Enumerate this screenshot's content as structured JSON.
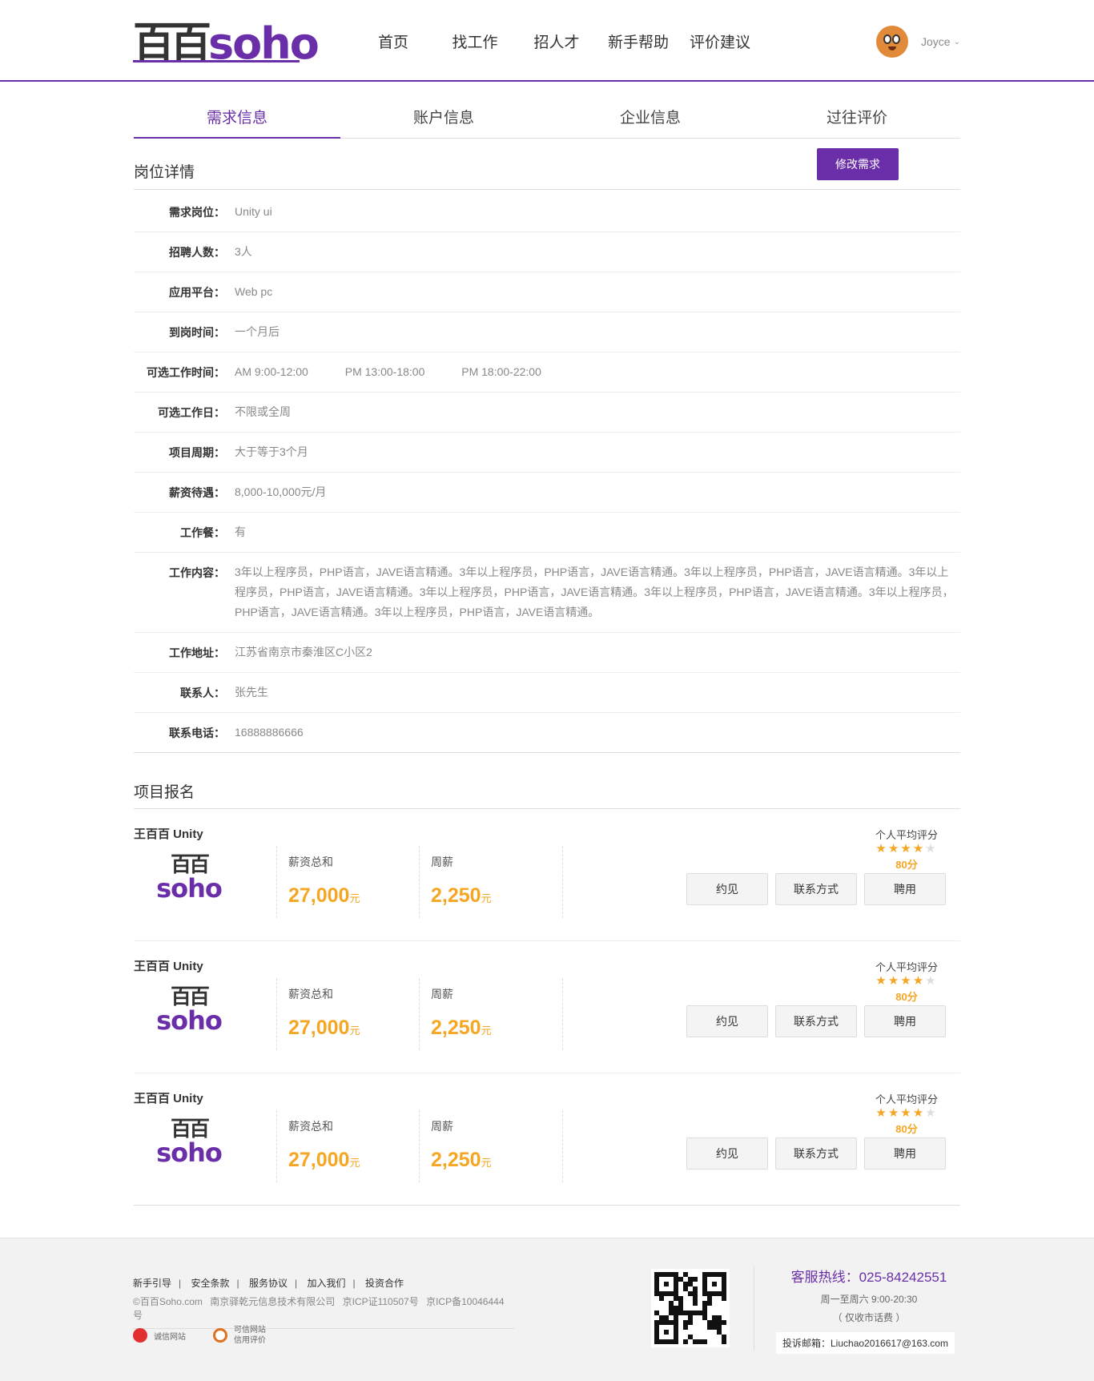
{
  "header": {
    "logo_han": "百百",
    "logo_latin": "soho",
    "nav": [
      "首页",
      "找工作",
      "招人才",
      "新手帮助",
      "评价建议"
    ],
    "user_name": "Joyce",
    "user_caret": "⌄"
  },
  "tabs": [
    "需求信息",
    "账户信息",
    "企业信息",
    "过往评价"
  ],
  "detail": {
    "title": "岗位详情",
    "edit_button": "修改需求",
    "rows": [
      {
        "label": "需求岗位：",
        "value": "Unity ui"
      },
      {
        "label": "招聘人数：",
        "value": "3人"
      },
      {
        "label": "应用平台：",
        "value": "Web pc"
      },
      {
        "label": "到岗时间：",
        "value": "一个月后"
      },
      {
        "label": "可选工作时间：",
        "values": [
          "AM 9:00-12:00",
          "PM 13:00-18:00",
          "PM 18:00-22:00"
        ]
      },
      {
        "label": "可选工作日：",
        "value": "不限或全周"
      },
      {
        "label": "项目周期：",
        "value": "大于等于3个月"
      },
      {
        "label": "薪资待遇：",
        "value": "8,000-10,000元/月"
      },
      {
        "label": "工作餐：",
        "value": "有"
      },
      {
        "label": "工作内容：",
        "value": "3年以上程序员，PHP语言，JAVE语言精通。3年以上程序员，PHP语言，JAVE语言精通。3年以上程序员，PHP语言，JAVE语言精通。3年以上程序员，PHP语言，JAVE语言精通。3年以上程序员，PHP语言，JAVE语言精通。3年以上程序员，PHP语言，JAVE语言精通。3年以上程序员，PHP语言，JAVE语言精通。3年以上程序员，PHP语言，JAVE语言精通。"
      },
      {
        "label": "工作地址：",
        "value": "江苏省南京市秦淮区C小区2"
      },
      {
        "label": "联系人：",
        "value": "张先生"
      },
      {
        "label": "联系电话：",
        "value": "16888886666"
      }
    ]
  },
  "applications": {
    "title": "项目报名",
    "items": [
      {
        "name": "王百百 Unity",
        "logo_han": "百百",
        "logo_latin": "soho",
        "total_label": "薪资总和",
        "total": "27,000",
        "total_unit": "元",
        "weekly_label": "周薪",
        "weekly": "2,250",
        "weekly_unit": "元",
        "rating_label": "个人平均评分",
        "stars": 4,
        "stars_max": 5,
        "score": "80分",
        "buttons": [
          "约见",
          "联系方式",
          "聘用"
        ]
      },
      {
        "name": "王百百 Unity",
        "logo_han": "百百",
        "logo_latin": "soho",
        "total_label": "薪资总和",
        "total": "27,000",
        "total_unit": "元",
        "weekly_label": "周薪",
        "weekly": "2,250",
        "weekly_unit": "元",
        "rating_label": "个人平均评分",
        "stars": 4,
        "stars_max": 5,
        "score": "80分",
        "buttons": [
          "约见",
          "联系方式",
          "聘用"
        ]
      },
      {
        "name": "王百百 Unity",
        "logo_han": "百百",
        "logo_latin": "soho",
        "total_label": "薪资总和",
        "total": "27,000",
        "total_unit": "元",
        "weekly_label": "周薪",
        "weekly": "2,250",
        "weekly_unit": "元",
        "rating_label": "个人平均评分",
        "stars": 4,
        "stars_max": 5,
        "score": "80分",
        "buttons": [
          "约见",
          "联系方式",
          "聘用"
        ]
      }
    ]
  },
  "footer": {
    "links": [
      "新手引导",
      "安全条款",
      "服务协议",
      "加入我们",
      "投资合作"
    ],
    "link_sep": "|",
    "copyright": [
      "©百百Soho.com",
      "南京驿乾元信息技术有限公司",
      "京ICP证110507号",
      "京ICP备10046444号"
    ],
    "badge1": "诚信网站",
    "badge2_line1": "可信网站",
    "badge2_line2": "信用评价",
    "hotline": "客服热线：025-84242551",
    "hours": "周一至周六 9:00-20:30",
    "note": "（ 仅收市话费 ）",
    "email": "投诉邮箱：Liuchao2016617@163.com"
  },
  "colors": {
    "brand": "#6a2fa8",
    "accent": "#f5a623"
  }
}
